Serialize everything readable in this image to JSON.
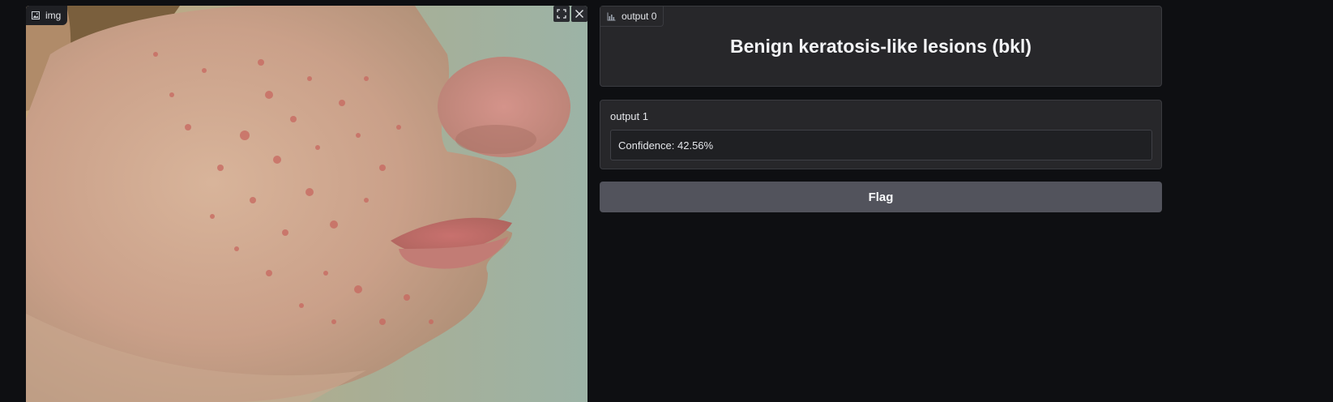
{
  "image_panel": {
    "label": "img",
    "label_icon": "image-icon",
    "fullscreen_icon": "fullscreen-icon",
    "close_icon": "close-icon"
  },
  "output0": {
    "label": "output 0",
    "label_icon": "bar-chart-icon",
    "title": "Benign keratosis-like lesions (bkl)"
  },
  "output1": {
    "label": "output 1",
    "value": "Confidence: 42.56%"
  },
  "flag_button": {
    "label": "Flag"
  },
  "colors": {
    "background": "#0e0f12",
    "panel": "#27272a",
    "button": "#52535c"
  }
}
